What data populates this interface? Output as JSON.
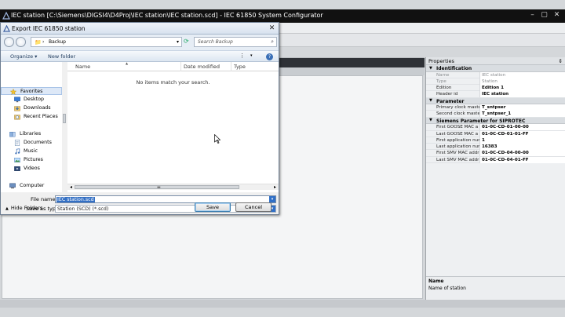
{
  "app": {
    "title": "IEC station [C:\\Siemens\\DIGSI4\\D4Proj\\IEC station\\IEC station.scd] - IEC 61850 System Configurator",
    "controls": {
      "minimize": "–",
      "maximize": "▢",
      "close": "✕"
    }
  },
  "dialog": {
    "title": "Export IEC 61850 station",
    "address_path": "Backup",
    "search_placeholder": "Search Backup",
    "organize_label": "Organize ▾",
    "new_folder_label": "New folder",
    "nav": {
      "favorites": "Favorites",
      "desktop": "Desktop",
      "downloads": "Downloads",
      "recent_places": "Recent Places",
      "libraries": "Libraries",
      "documents": "Documents",
      "music": "Music",
      "pictures": "Pictures",
      "videos": "Videos",
      "computer": "Computer"
    },
    "columns": {
      "name": "Name",
      "date_modified": "Date modified",
      "type": "Type"
    },
    "empty_message": "No items match your search.",
    "file_name_label": "File name:",
    "file_name_value": "IEC station.scd",
    "save_as_type_label": "Save as type:",
    "save_as_type_value": "Station (SCD) (*.scd)",
    "hide_folders_label": "Hide Folders",
    "save_label": "Save",
    "cancel_label": "Cancel"
  },
  "properties": {
    "title": "Properties",
    "pin": "⇕",
    "sections": [
      {
        "label": "Identification",
        "rows": [
          {
            "key": "Name",
            "value": "IEC station",
            "disabled": true
          },
          {
            "key": "Type",
            "value": "Station",
            "disabled": true
          },
          {
            "key": "Edition",
            "value": "Edition 1",
            "disabled": false
          },
          {
            "key": "Header id",
            "value": "IEC station",
            "disabled": false
          }
        ]
      },
      {
        "label": "Parameter",
        "rows": [
          {
            "key": "Primary clock maste",
            "value": "T_sntpser",
            "disabled": false
          },
          {
            "key": "Second clock maste",
            "value": "T_sntpser_1",
            "disabled": false
          }
        ]
      },
      {
        "label": "Siemens Parameter for SIPROTEC",
        "rows": [
          {
            "key": "First GOOSE MAC a",
            "value": "01-0C-CD-01-00-00",
            "disabled": false
          },
          {
            "key": "Last GOOSE MAC a",
            "value": "01-0C-CD-01-01-FF",
            "disabled": false
          },
          {
            "key": "First application nur",
            "value": "1",
            "disabled": false
          },
          {
            "key": "Last application nur",
            "value": "16383",
            "disabled": false
          },
          {
            "key": "First SMV MAC addr",
            "value": "01-0C-CD-04-00-00",
            "disabled": false
          },
          {
            "key": "Last SMV MAC addr",
            "value": "01-0C-CD-04-01-FF",
            "disabled": false
          }
        ]
      }
    ],
    "desc_title": "Name",
    "desc_text": "Name of station"
  },
  "colors": {
    "titlebar": "#111111",
    "selection": "#3470c4",
    "dialog_nav": "#e6edf5"
  }
}
